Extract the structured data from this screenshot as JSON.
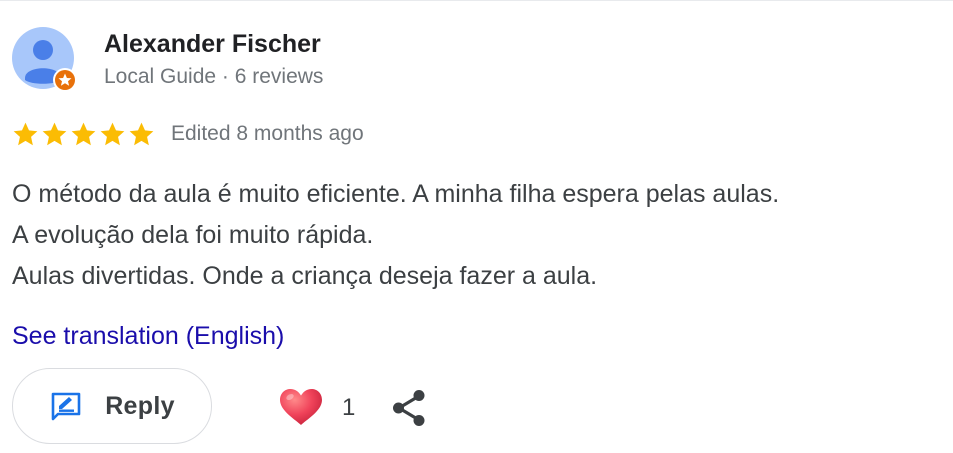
{
  "reviewer": {
    "name": "Alexander Fischer",
    "meta": "Local Guide · 6 reviews",
    "avatar_icon": "person-avatar-icon",
    "badge_icon": "local-guide-star-badge-icon"
  },
  "rating": {
    "stars": 5,
    "max_stars": 5,
    "edited_label": "Edited 8 months ago"
  },
  "review": {
    "lines": [
      "O método da aula é muito eficiente. A minha filha espera pelas aulas.",
      "A evolução dela foi muito rápida.",
      "Aulas divertidas. Onde a criança deseja fazer a aula."
    ]
  },
  "translation_link": "See translation (English)",
  "actions": {
    "reply_label": "Reply",
    "reply_icon": "reply-edit-icon",
    "like_icon": "heart-icon",
    "like_count": "1",
    "share_icon": "share-icon"
  },
  "colors": {
    "star": "#fbbc04",
    "link": "#1a0dab",
    "reply_icon": "#1a73e8",
    "heart": "#e53950",
    "avatar_bg": "#8ab4f8",
    "avatar_person": "#4285f4",
    "badge": "#e8710a"
  }
}
